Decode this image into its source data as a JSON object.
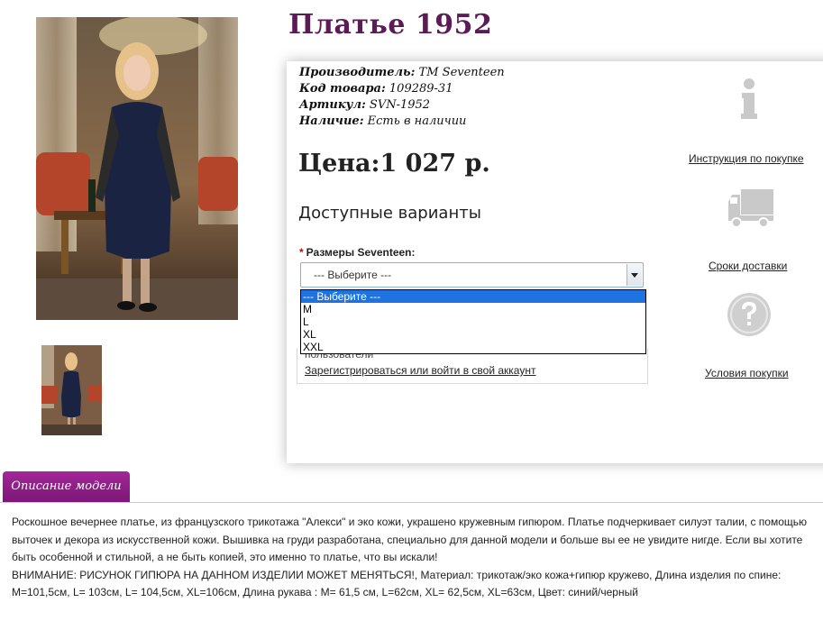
{
  "product": {
    "title": "Платье 1952",
    "meta": [
      {
        "label": "Производитель:",
        "value": " TM Seventeen"
      },
      {
        "label": "Код товара:",
        "value": " 109289-31"
      },
      {
        "label": "Артикул:",
        "value": " SVN-1952"
      },
      {
        "label": "Наличие:",
        "value": " Есть в наличии"
      }
    ],
    "price": "Цена:1 027 р."
  },
  "variants": {
    "title": "Доступные варианты",
    "size_label": "Размеры Seventeen:",
    "required_mark": "*",
    "selected": "--- Выберите ---",
    "options": [
      "--- Выберите ---",
      "M",
      "L",
      "XL",
      "XXL"
    ]
  },
  "login": {
    "note": "пользователи",
    "link": "Зарегистрироваться или войти в свой аккаунт"
  },
  "side_links": {
    "instruction": "Инструкция по покупке",
    "delivery": "Сроки доставки",
    "conditions": "Условия покупки"
  },
  "description": {
    "tab_label": "Описание модели",
    "text": "Роскошное вечернее платье, из французского трикотажа \"Алекси\" и эко кожи, украшено кружевным гипюром. Платье подчеркивает силуэт талии, с помощью выточек и декора из искусственной кожи. Вышивка на груди разработана, специально для данной модели и больше вы ее не увидите нигде. Если вы хотите быть особенной и стильной, а не быть копией, это именно то платье, что вы искали!",
    "notice": "ВНИМАНИЕ: РИСУНОК ГИПЮРА НА ДАННОМ ИЗДЕЛИИ МОЖЕТ МЕНЯТЬСЯ!",
    "specs": ", Материал: трикотаж/эко кожа+гипюр кружево, Длина изделия по спине: M=101,5см, L= 103см, L= 104,5см, XL=106см, Длина рукава : M= 61,5 см, L=62см, XL= 62,5см, XL=63см, Цвет: синий/черный"
  },
  "colors": {
    "title": "#5b1b56",
    "tab": "#8f1f88",
    "option_highlight": "#1e73e0",
    "required": "#d00000"
  },
  "icons": [
    "info-icon",
    "truck-icon",
    "question-icon"
  ]
}
